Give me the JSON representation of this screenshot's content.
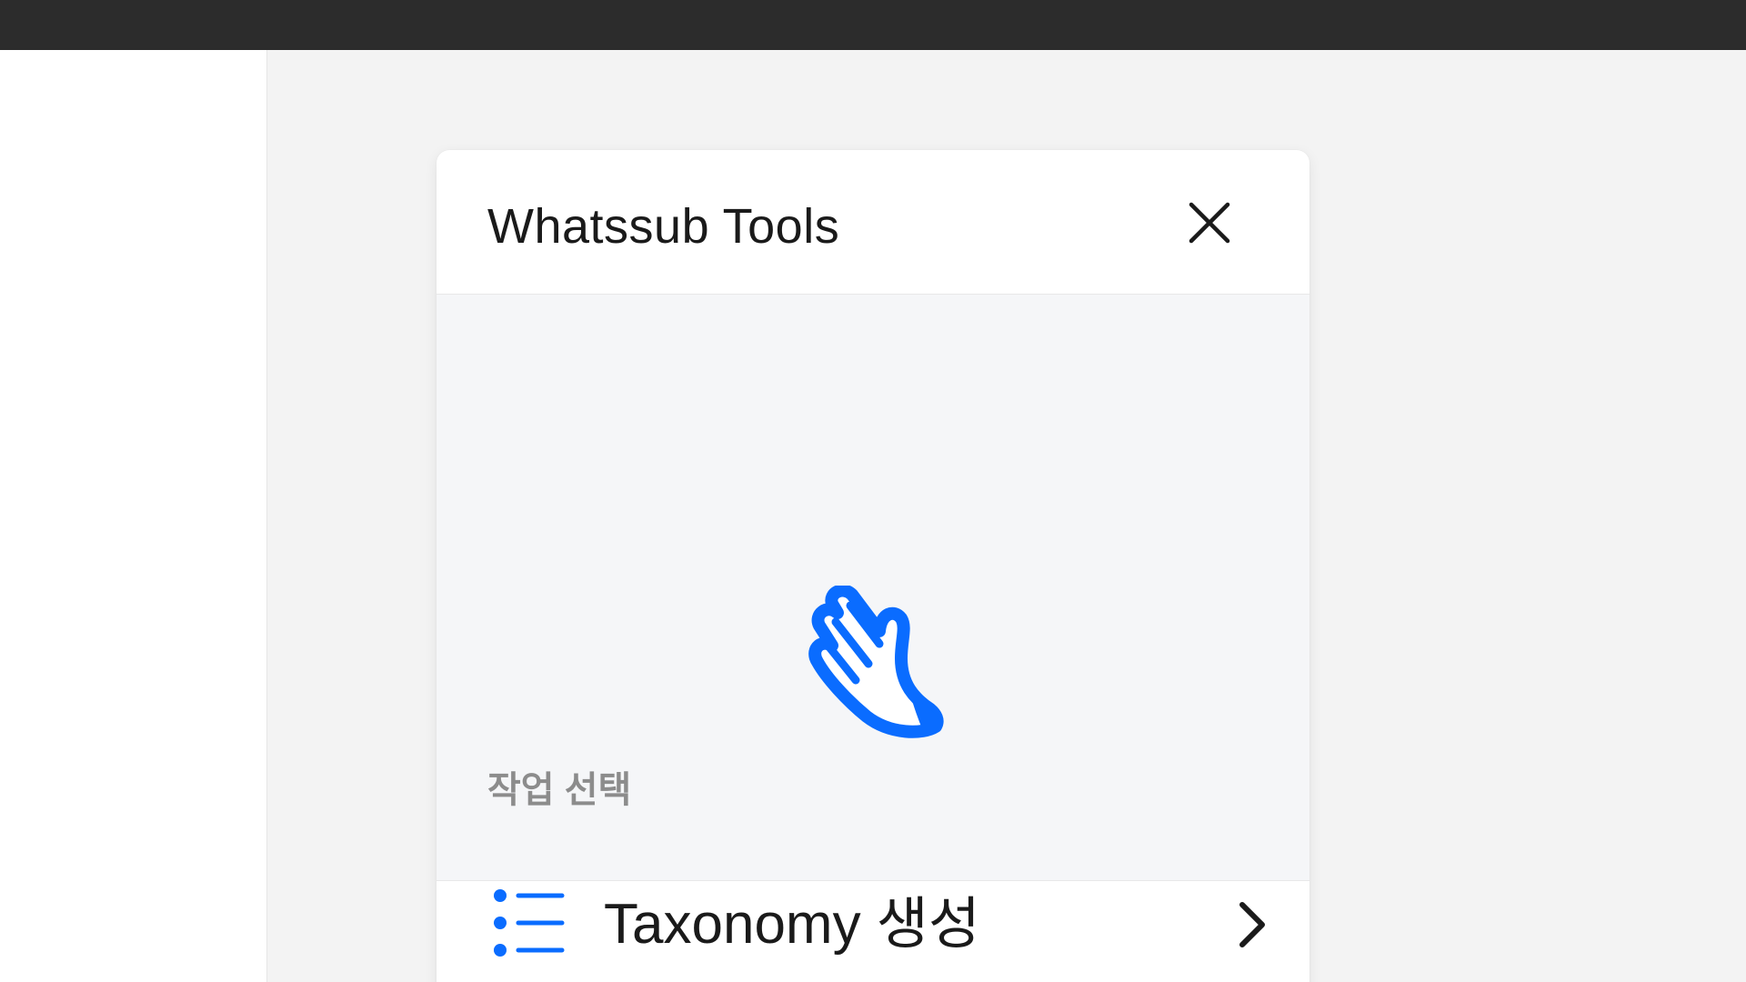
{
  "plugin": {
    "title": "Whatssub Tools",
    "section_label": "작업 선택",
    "menu_items": [
      {
        "label": "Taxonomy 생성",
        "icon": "list-icon"
      }
    ]
  },
  "icons": {
    "close": "close-icon",
    "hero": "waving-hand-icon",
    "menu_chevron": "chevron-right-icon"
  },
  "colors": {
    "accent": "#0a6cff",
    "top_bar": "#2c2c2c",
    "canvas": "#f3f3f3",
    "hero_background": "#f5f6f8",
    "title_text": "#1a1a1a",
    "section_label": "#8c8c8c"
  }
}
